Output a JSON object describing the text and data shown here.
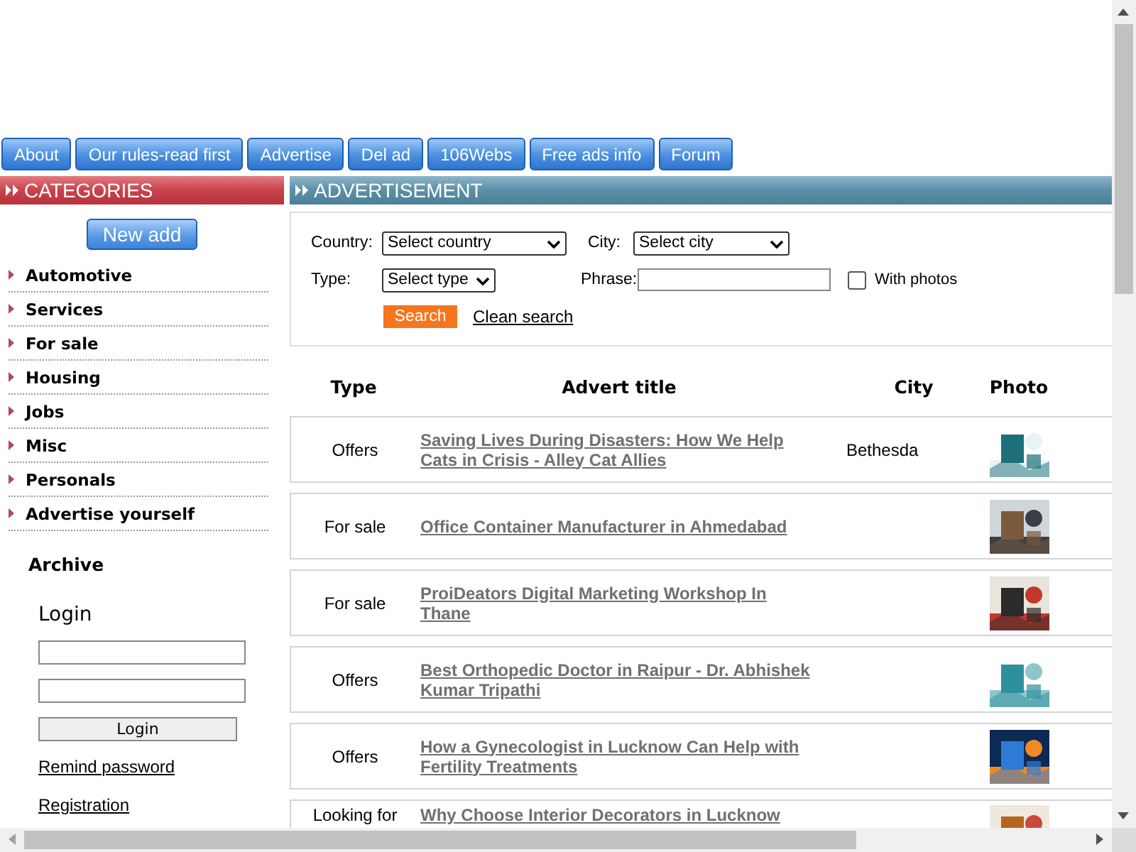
{
  "nav": [
    {
      "label": "About"
    },
    {
      "label": "Our rules-read first"
    },
    {
      "label": "Advertise"
    },
    {
      "label": "Del ad"
    },
    {
      "label": "106Webs"
    },
    {
      "label": "Free ads info"
    },
    {
      "label": "Forum"
    }
  ],
  "categories": {
    "title": "CATEGORIES",
    "new_button": "New add",
    "items": [
      "Automotive",
      "Services",
      "For sale",
      "Housing",
      "Jobs",
      "Misc",
      "Personals",
      "Advertise yourself"
    ],
    "archive": "Archive"
  },
  "login": {
    "title": "Login",
    "button": "Login",
    "links": [
      "Remind password",
      "Registration"
    ]
  },
  "advertisement": {
    "title": "ADVERTISEMENT",
    "filters": {
      "country_label": "Country:",
      "country_select": "Select country",
      "city_label": "City:",
      "city_select": "Select city",
      "type_label": "Type:",
      "type_select": "Select type",
      "phrase_label": "Phrase:",
      "with_photos_label": "With photos",
      "with_photos_checked": false,
      "search_button": "Search",
      "clean_link": "Clean search"
    },
    "columns": [
      "Type",
      "Advert title",
      "City",
      "Photo"
    ],
    "rows": [
      {
        "type": "Offers",
        "title": "Saving Lives During Disasters: How We Help Cats in Crisis - Alley Cat Allies",
        "city": "Bethesda"
      },
      {
        "type": "For sale",
        "title": "Office Container Manufacturer in Ahmedabad"
      },
      {
        "type": "For sale",
        "title": "ProiDeators Digital Marketing Workshop In Thane"
      },
      {
        "type": "Offers",
        "title": "Best Orthopedic Doctor in Raipur - Dr. Abhishek Kumar Tripathi"
      },
      {
        "type": "Offers",
        "title": "How a Gynecologist in Lucknow Can Help with Fertility Treatments"
      },
      {
        "type": "Looking for",
        "title": "Why Choose Interior Decorators in Lucknow"
      }
    ]
  }
}
